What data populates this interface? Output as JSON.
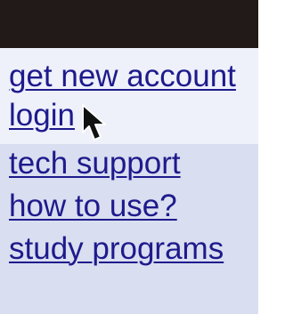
{
  "colors": {
    "top_bar": "#221a18",
    "panel_upper": "#eef0fa",
    "panel_lower": "#d9def0",
    "link": "#1e1a8c"
  },
  "menu": {
    "items": [
      {
        "label": "get new account",
        "icon": ""
      },
      {
        "label": "login",
        "icon": ""
      },
      {
        "label": "tech support",
        "icon": ""
      },
      {
        "label": "how to use?",
        "icon": ""
      },
      {
        "label": "study programs",
        "icon": ""
      }
    ]
  },
  "cursor": {
    "icon": "mouse-pointer-arrow"
  }
}
